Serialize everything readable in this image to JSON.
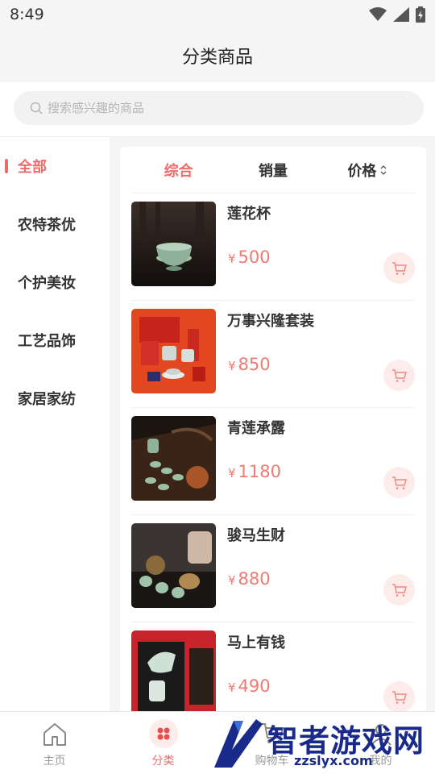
{
  "status_bar": {
    "time": "8:49"
  },
  "header": {
    "title": "分类商品"
  },
  "search": {
    "placeholder": "搜索感兴趣的商品"
  },
  "sidebar": {
    "items": [
      {
        "label": "全部",
        "active": true
      },
      {
        "label": "农特茶优",
        "active": false
      },
      {
        "label": "个护美妆",
        "active": false
      },
      {
        "label": "工艺品饰",
        "active": false
      },
      {
        "label": "家居家纺",
        "active": false
      }
    ]
  },
  "sort": {
    "tabs": [
      {
        "label": "综合",
        "active": true
      },
      {
        "label": "销量",
        "active": false
      },
      {
        "label": "价格",
        "active": false
      }
    ]
  },
  "currency_symbol": "¥",
  "products": [
    {
      "name": "莲花杯",
      "price": "500"
    },
    {
      "name": "万事兴隆套装",
      "price": "850"
    },
    {
      "name": "青莲承露",
      "price": "1180"
    },
    {
      "name": "骏马生财",
      "price": "880"
    },
    {
      "name": "马上有钱",
      "price": "490"
    }
  ],
  "tabbar": {
    "items": [
      {
        "label": "主页",
        "icon": "home-icon",
        "active": false
      },
      {
        "label": "分类",
        "icon": "category-icon",
        "active": true
      },
      {
        "label": "购物车",
        "icon": "cart-icon",
        "active": false
      },
      {
        "label": "我的",
        "icon": "profile-icon",
        "active": false
      }
    ]
  },
  "watermark": {
    "text": "智者游戏网",
    "url": "zzslyx.com"
  },
  "colors": {
    "accent": "#ee6b6b",
    "price": "#ee7b73",
    "cart_bg": "#fdecea"
  }
}
